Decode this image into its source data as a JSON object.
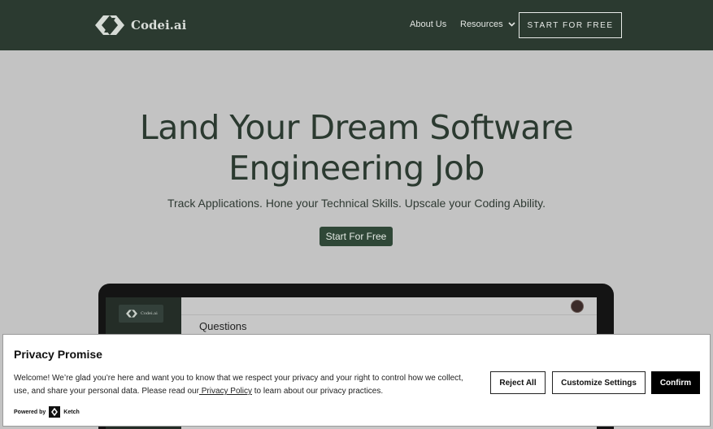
{
  "header": {
    "brand": "Codei.ai",
    "nav": {
      "about": "About Us",
      "resources": "Resources"
    },
    "cta": "START FOR FREE"
  },
  "hero": {
    "title_line1": "Land Your Dream Software",
    "title_line2": "Engineering Job",
    "subtitle": "Track Applications. Hone your Technical Skills. Upscale your Coding Ability.",
    "button": "Start For Free"
  },
  "preview": {
    "brand": "Codei.ai",
    "heading": "Questions"
  },
  "consent": {
    "title": "Privacy Promise",
    "text_before": "Welcome! We’re glad you’re here and want you to know that we respect your privacy and your right to control how we collect, use, and share your personal data. Please read our",
    "link": " Privacy Policy",
    "text_after": " to learn about our privacy practices.",
    "powered_by": "Powered by",
    "vendor": "Ketch",
    "reject": "Reject All",
    "customize": "Customize Settings",
    "confirm": "Confirm"
  },
  "colors": {
    "header_bg": "#2b3a30",
    "page_bg": "#c3c3c3",
    "brand_dark": "#2f4737"
  }
}
